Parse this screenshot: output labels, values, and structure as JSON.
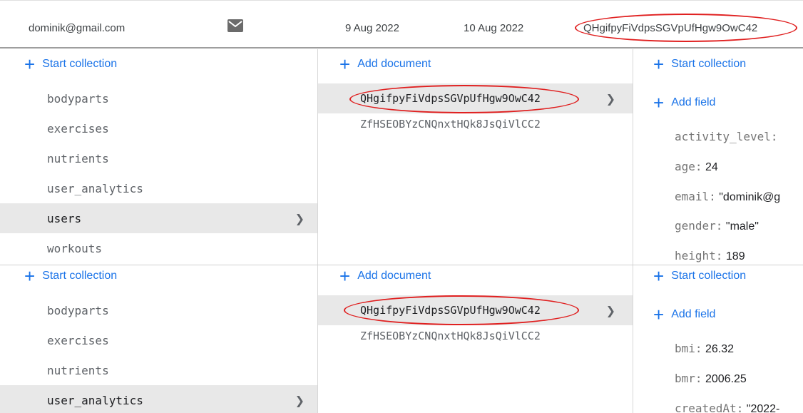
{
  "user_row": {
    "email": "dominik@gmail.com",
    "date_created": "9 Aug 2022",
    "date_signed_in": "10 Aug 2022",
    "uid": "QHgifpyFiVdpsSGVpUfHgw9OwC42",
    "icon": "mail-icon"
  },
  "panel1": {
    "root": {
      "action": "Start collection",
      "collections": [
        "bodyparts",
        "exercises",
        "nutrients",
        "user_analytics",
        "users",
        "workouts"
      ],
      "selected": "users"
    },
    "collection": {
      "action": "Add document",
      "documents": [
        "QHgifpyFiVdpsSGVpUfHgw9OwC42",
        "ZfHSEOBYzCNQnxtHQk8JsQiVlCC2"
      ]
    },
    "document": {
      "action_collection": "Start collection",
      "action_field": "Add field",
      "fields": [
        {
          "key": "activity_level:",
          "value": ""
        },
        {
          "key": "age:",
          "value": "24"
        },
        {
          "key": "email:",
          "value": "\"dominik@g"
        },
        {
          "key": "gender:",
          "value": "\"male\""
        },
        {
          "key": "height:",
          "value": "189"
        }
      ]
    }
  },
  "panel2": {
    "root": {
      "action": "Start collection",
      "collections": [
        "bodyparts",
        "exercises",
        "nutrients",
        "user_analytics"
      ],
      "selected": "user_analytics"
    },
    "collection": {
      "action": "Add document",
      "documents": [
        "QHgifpyFiVdpsSGVpUfHgw9OwC42",
        "ZfHSEOBYzCNQnxtHQk8JsQiVlCC2"
      ]
    },
    "document": {
      "action_collection": "Start collection",
      "action_field": "Add field",
      "fields": [
        {
          "key": "bmi:",
          "value": "26.32"
        },
        {
          "key": "bmr:",
          "value": "2006.25"
        },
        {
          "key": "createdAt:",
          "value": "\"2022-"
        }
      ]
    }
  },
  "colors": {
    "accent": "#1a73e8",
    "annotation": "#e02020",
    "selected_bg": "#e8e8e8"
  }
}
